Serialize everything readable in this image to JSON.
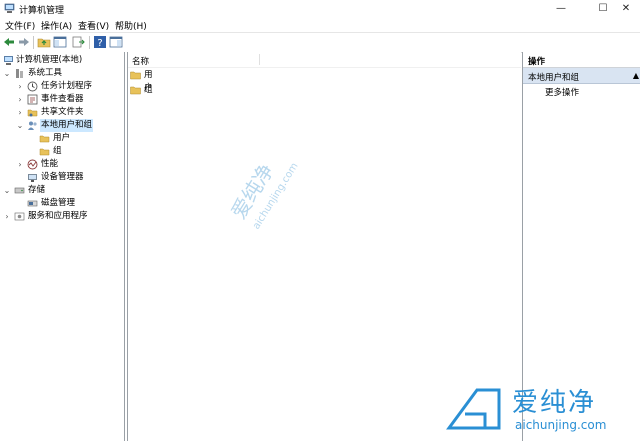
{
  "window": {
    "title": "计算机管理",
    "minimize": "—",
    "maximize": "☐",
    "close": "✕"
  },
  "menu": [
    "文件(F)",
    "操作(A)",
    "查看(V)",
    "帮助(H)"
  ],
  "tree": [
    {
      "label": "计算机管理(本地)",
      "expander": ""
    },
    {
      "label": "系统工具",
      "expander": "⌄"
    },
    {
      "label": "任务计划程序",
      "expander": "›"
    },
    {
      "label": "事件查看器",
      "expander": "›"
    },
    {
      "label": "共享文件夹",
      "expander": "›"
    },
    {
      "label": "本地用户和组",
      "expander": "⌄"
    },
    {
      "label": "用户",
      "expander": ""
    },
    {
      "label": "组",
      "expander": ""
    },
    {
      "label": "性能",
      "expander": "›"
    },
    {
      "label": "设备管理器",
      "expander": ""
    },
    {
      "label": "存储",
      "expander": "⌄"
    },
    {
      "label": "磁盘管理",
      "expander": ""
    },
    {
      "label": "服务和应用程序",
      "expander": "›"
    }
  ],
  "list": {
    "column_name": "名称",
    "items": [
      "用户",
      "组"
    ]
  },
  "actions": {
    "header": "操作",
    "section": "本地用户和组",
    "section_arrow": "▲",
    "more": "更多操作"
  },
  "watermark": {
    "brand": "爱纯净",
    "url": "aichunjing.com"
  },
  "colors": {
    "selection": "#cce8ff",
    "actions_section": "#d9e4f2",
    "watermark": "#2a8fd4",
    "folder": "#e8c25a"
  }
}
